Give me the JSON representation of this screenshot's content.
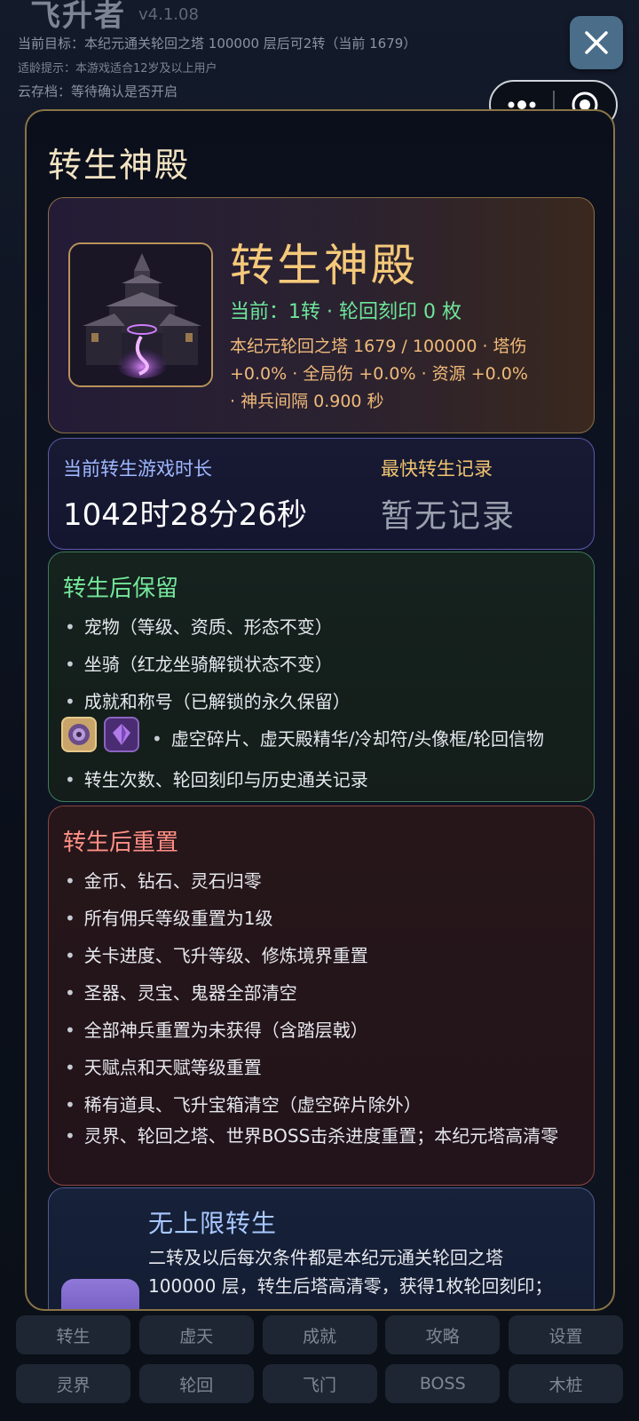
{
  "background": {
    "app_title": "飞升者",
    "version": "v4.1.08",
    "target_line": "当前目标：本纪元通关轮回之塔 100000 层后可2转（当前 1679）",
    "age_tip": "适龄提示：本游戏适合12岁及以上用户",
    "cloud_save": "云存档：等待确认是否开启"
  },
  "modal": {
    "title": "转生神殿",
    "hero": {
      "image_icon": "reincarnation-temple-icon",
      "name": "转生神殿",
      "status": "当前：1转 · 轮回刻印 0 枚",
      "stats_line1": "本纪元轮回之塔 1679 / 100000 · 塔伤",
      "stats_line2": "+0.0% · 全局伤 +0.0% · 资源 +0.0%",
      "stats_line3": "· 神兵间隔 0.900 秒"
    },
    "time": {
      "current_label": "当前转生游戏时长",
      "current_value": "1042时28分26秒",
      "record_label": "最快转生记录",
      "record_value": "暂无记录"
    },
    "keep": {
      "title": "转生后保留",
      "items": [
        "宠物（等级、资质、形态不变）",
        "坐骑（红龙坐骑解锁状态不变）",
        "成就和称号（已解锁的永久保留）",
        "虚空碎片、虚天殿精华/冷却符/头像框/轮回信物",
        "转生次数、轮回刻印与历史通关记录"
      ],
      "item_icons": [
        "void-shard-icon",
        "purple-crystal-icon"
      ]
    },
    "reset": {
      "title": "转生后重置",
      "items": [
        "金币、钻石、灵石归零",
        "所有佣兵等级重置为1级",
        "关卡进度、飞升等级、修炼境界重置",
        "圣器、灵宝、鬼器全部清空",
        "全部神兵重置为未获得（含踏层戟）",
        "天赋点和天赋等级重置",
        "稀有道具、飞升宝箱清空（虚空碎片除外）",
        "灵界、轮回之塔、世界BOSS击杀进度重置；本纪元塔高清零"
      ]
    },
    "unlimited": {
      "title": "无上限转生",
      "desc": "二转及以后每次条件都是本纪元通关轮回之塔 100000 层，转生后塔高清零，获得1枚轮回刻印；",
      "icon": "rune-icon"
    }
  },
  "top_controls": {
    "close_icon": "close-icon",
    "more_icon": "more-dots-icon",
    "target_icon": "target-circle-icon"
  },
  "nav": {
    "row1": [
      "转生",
      "虚天",
      "成就",
      "攻略",
      "设置"
    ],
    "row2": [
      "灵界",
      "轮回",
      "飞门",
      "BOSS",
      "木桩"
    ]
  },
  "colors": {
    "gold_border": "#8a7446",
    "hero_gold": "#f5c97a",
    "keep_green": "#74e69a",
    "reset_red": "#ff8f85"
  }
}
